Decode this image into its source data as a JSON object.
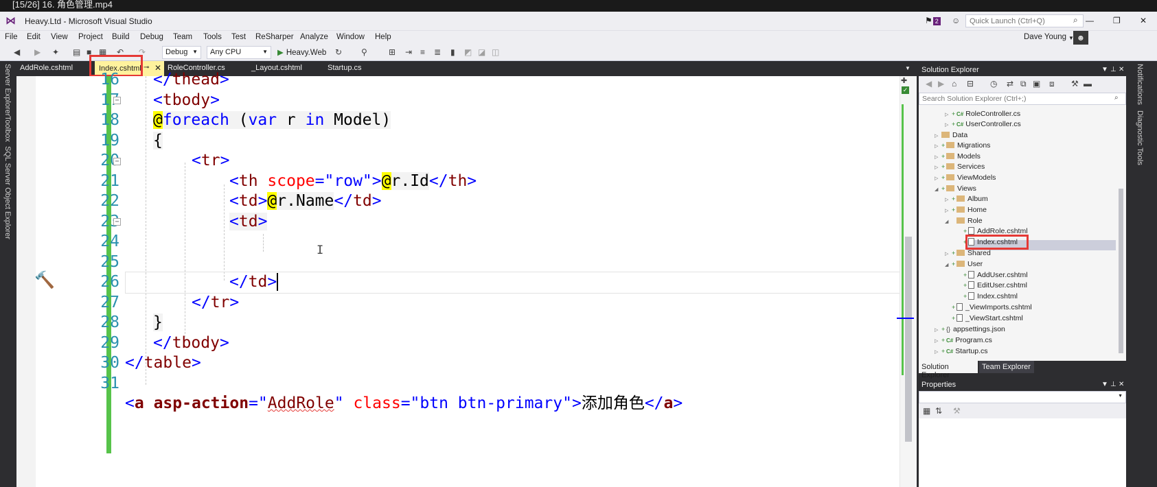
{
  "player": {
    "title": "[15/26] 16. 角色管理.mp4"
  },
  "window": {
    "title": "Heavy.Ltd - Microsoft Visual Studio",
    "notification_count": "2",
    "quick_launch_placeholder": "Quick Launch (Ctrl+Q)",
    "user": "Dave Young"
  },
  "menu": [
    "File",
    "Edit",
    "View",
    "Project",
    "Build",
    "Debug",
    "Team",
    "Tools",
    "Test",
    "ReSharper",
    "Analyze",
    "Window",
    "Help"
  ],
  "toolbar": {
    "configuration": "Debug",
    "platform": "Any CPU",
    "start_target": "Heavy.Web"
  },
  "left_tool_tabs": [
    "Server Explorer",
    "Toolbox",
    "SQL Server Object Explorer"
  ],
  "right_tool_tabs": [
    "Notifications",
    "Diagnostic Tools"
  ],
  "tabs": [
    {
      "label": "AddRole.cshtml",
      "active": false
    },
    {
      "label": "Index.cshtml",
      "active": true
    },
    {
      "label": "RoleController.cs",
      "active": false
    },
    {
      "label": "_Layout.cshtml",
      "active": false
    },
    {
      "label": "Startup.cs",
      "active": false
    }
  ],
  "editor": {
    "lines": [
      {
        "num": "16",
        "text": "</thead>"
      },
      {
        "num": "17",
        "text": "<tbody>"
      },
      {
        "num": "18",
        "text": "@foreach (var r in Model)"
      },
      {
        "num": "19",
        "text": "{"
      },
      {
        "num": "20",
        "text": "<tr>"
      },
      {
        "num": "21",
        "text": "<th scope=\"row\">@r.Id</th>"
      },
      {
        "num": "22",
        "text": "<td>@r.Name</td>"
      },
      {
        "num": "23",
        "text": "<td>"
      },
      {
        "num": "24",
        "text": ""
      },
      {
        "num": "25",
        "text": "</td>"
      },
      {
        "num": "26",
        "text": "</tr>"
      },
      {
        "num": "27",
        "text": "}"
      },
      {
        "num": "28",
        "text": "</tbody>"
      },
      {
        "num": "29",
        "text": "</table>"
      },
      {
        "num": "30",
        "text": ""
      },
      {
        "num": "31",
        "text": "<a asp-action=\"AddRole\" class=\"btn btn-primary\">添加角色</a>"
      }
    ],
    "tokens": {
      "thead": "thead",
      "tbody": "tbody",
      "foreach_at": "@",
      "foreach": "foreach",
      "paren_open": " (",
      "var": "var",
      "r": " r ",
      "in": "in",
      "model": " Model)",
      "brace_open": "{",
      "tr": "tr",
      "th": "th",
      "scope": "scope",
      "eq": "=",
      "row_str": "\"row\"",
      "at": "@",
      "r_id": "r.Id",
      "td": "td",
      "r_name": "r.Name",
      "brace_close": "}",
      "table": "table",
      "a": "a",
      "asp_action": "asp-action",
      "q": "\"",
      "addrole": "AddRole",
      "class_attr": "class",
      "class_val": "\"btn btn-primary\"",
      "link_text": "添加角色"
    }
  },
  "solution_explorer": {
    "title": "Solution Explorer",
    "search_placeholder": "Search Solution Explorer (Ctrl+;)",
    "items": [
      "RoleController.cs",
      "UserController.cs",
      "Data",
      "Migrations",
      "Models",
      "Services",
      "ViewModels",
      "Views",
      "Album",
      "Home",
      "Role",
      "AddRole.cshtml",
      "Index.cshtml",
      "Shared",
      "User",
      "AddUser.cshtml",
      "EditUser.cshtml",
      "Index.cshtml",
      "_ViewImports.cshtml",
      "_ViewStart.cshtml",
      "appsettings.json",
      "Program.cs",
      "Startup.cs"
    ],
    "selected_item": "Index.cshtml",
    "bottom_tabs": [
      "Solution Explorer",
      "Team Explorer"
    ]
  },
  "properties": {
    "title": "Properties"
  },
  "colors": {
    "active_tab": "#fff29d",
    "highlight_box": "#e53935",
    "change_bar": "#57c34a",
    "line_numbers": "#2b91af",
    "vs_purple": "#68217a"
  }
}
